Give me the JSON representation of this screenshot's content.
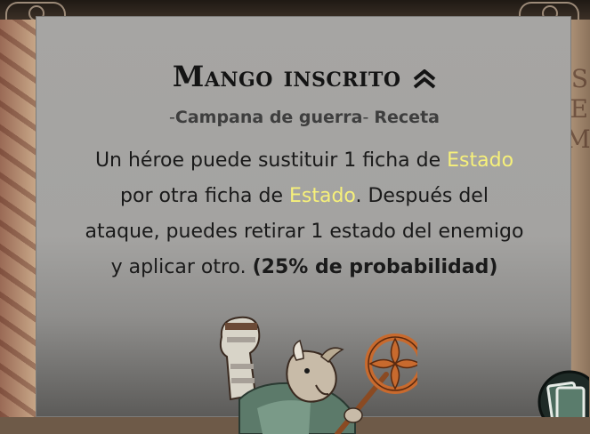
{
  "card": {
    "title": "Mango inscrito",
    "subtitle_prefix": "-",
    "subtitle_source": "Campana de guerra",
    "subtitle_sep": "- ",
    "subtitle_type": "Receta",
    "desc_line1_a": "Un héroe puede sustituir 1 ficha de ",
    "desc_line1_hl": "Estado",
    "desc_line2_a": "por otra ficha de ",
    "desc_line2_hl": "Estado",
    "desc_line2_b": ". Después del",
    "desc_line3": "ataque, puedes retirar 1 estado del enemigo",
    "desc_line4_a": "y aplicar otro. ",
    "desc_line4_bold": "(25% de probabilidad)",
    "rank_icon": "double-chevron-up-icon"
  },
  "colors": {
    "highlight": "#f6f07a",
    "panel": "#a6a5a3"
  }
}
